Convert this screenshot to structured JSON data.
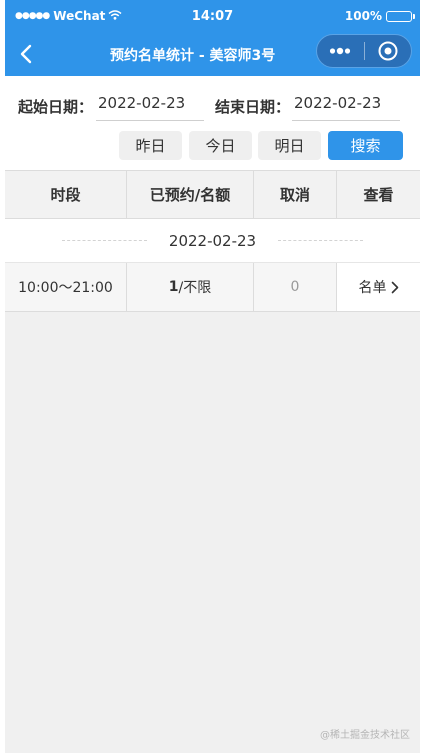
{
  "status_bar": {
    "signal": "●●●●●",
    "carrier": "WeChat",
    "time": "14:07",
    "battery": "100%",
    "battery_level": 1.0
  },
  "nav": {
    "title": "预约名单统计 - 美容师3号"
  },
  "filter": {
    "start_label": "起始日期：",
    "start_value": "2022-02-23",
    "end_label": "结束日期：",
    "end_value": "2022-02-23",
    "buttons": {
      "yesterday": "昨日",
      "today": "今日",
      "tomorrow": "明日",
      "search": "搜索"
    }
  },
  "table": {
    "headers": [
      "时段",
      "已预约/名额",
      "取消",
      "查看"
    ],
    "group_date": "2022-02-23",
    "rows": [
      {
        "time_slot": "10:00～21:00",
        "booked": "1",
        "quota": "/不限",
        "cancelled": "0",
        "view": "名单"
      }
    ]
  },
  "watermark": "@稀土掘金技术社区",
  "colors": {
    "primary": "#2f94e9",
    "capsule": "#2a6fb7",
    "background": "#f0f0f0"
  }
}
